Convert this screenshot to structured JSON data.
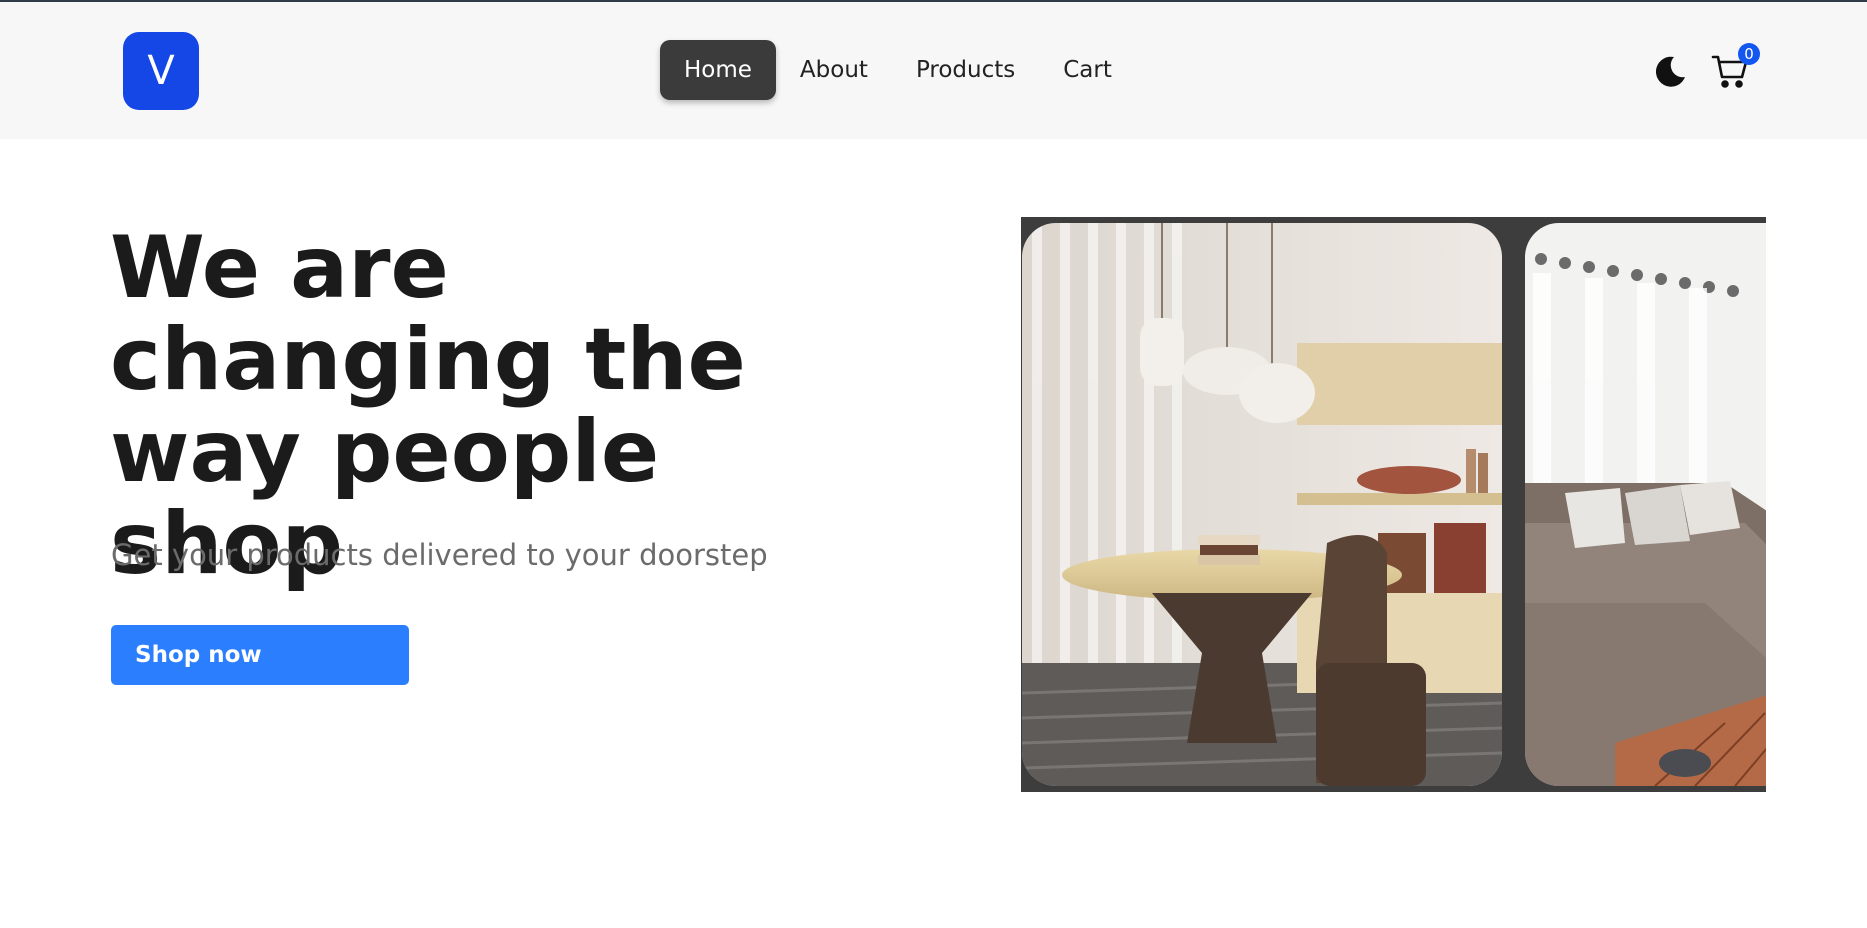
{
  "navbar": {
    "logo_letter": "V",
    "links": [
      {
        "label": "Home",
        "active": true
      },
      {
        "label": "About",
        "active": false
      },
      {
        "label": "Products",
        "active": false
      },
      {
        "label": "Cart",
        "active": false
      }
    ],
    "theme_icon": "moon-icon",
    "cart_icon": "cart-icon",
    "cart_count": "0"
  },
  "hero": {
    "title": "We are changing the way people shop",
    "subtitle": "Get your products delivered to your doorstep",
    "cta_label": "Shop now"
  },
  "carousel": {
    "slides": [
      {
        "image": "dining-room-photo"
      },
      {
        "image": "living-room-sofa-photo"
      }
    ]
  },
  "colors": {
    "brand": "#1447e6",
    "cta": "#2b7fff",
    "active_nav": "#3b3b3b",
    "badge": "#1457f0"
  }
}
